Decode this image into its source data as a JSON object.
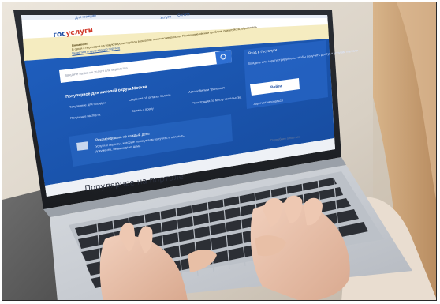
{
  "site": {
    "logo_part1": "гос",
    "logo_part2": "услуги",
    "top_links": [
      "Для граждан",
      "Услуги",
      "Оплата"
    ],
    "notice_lines": [
      "Внимание!",
      "В связи с переходом на новую версию портала возможны технические работы. При возникновении проблем, пожалуйста, обратитесь",
      "Перейти в старую версию портала"
    ],
    "search_placeholder": "Введите название услуги или ведомства",
    "section_title": "Популярное для жителей округа Москва",
    "popular_items": [
      "Популярное для граждан",
      "Сведения об остатке баллов",
      "Автомобили и транспорт",
      "Получение паспорта",
      "Запись к врачу",
      "Регистрация по месту жительства"
    ],
    "promo_line1": "Рекомендовано на каждый день",
    "promo_line2": "Услуги и сервисы, которые помогут вам получить и оплатить",
    "promo_line3": "документы, не выходя из дома",
    "login_title": "Вход в Госуслуги",
    "login_desc": "Войдите или зарегистрируйтесь, чтобы получить доступ к услугам портала",
    "login_button": "Войти",
    "register_link": "Зарегистрироваться",
    "more_link": "Подробнее о портале",
    "popular_heading": "Популярное на портале"
  },
  "colors": {
    "brand_blue": "#1f5fbf",
    "notice_yellow": "#f5ecc0",
    "logo_red": "#d13a2b"
  }
}
